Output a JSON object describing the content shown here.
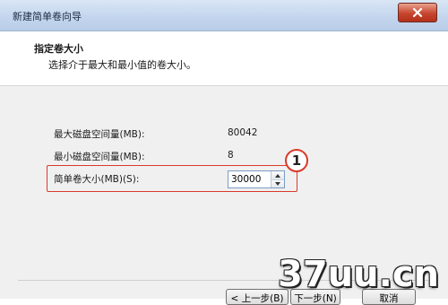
{
  "window": {
    "title": "新建简单卷向导"
  },
  "header": {
    "title": "指定卷大小",
    "subtitle": "选择介于最大和最小值的卷大小。"
  },
  "fields": {
    "max_label": "最大磁盘空间量(MB):",
    "max_value": "80042",
    "min_label": "最小磁盘空间量(MB):",
    "min_value": "8",
    "size_label": "简单卷大小(MB)(S):",
    "size_value": "30000"
  },
  "callout": {
    "number": "1"
  },
  "buttons": {
    "back": "< 上一步(B)",
    "next": "下一步(N)",
    "cancel": "取消"
  },
  "watermark": "37uu.cn",
  "colors": {
    "highlight": "#d93a2b",
    "titlebar": "#c4d6ee",
    "close": "#c7452f"
  }
}
